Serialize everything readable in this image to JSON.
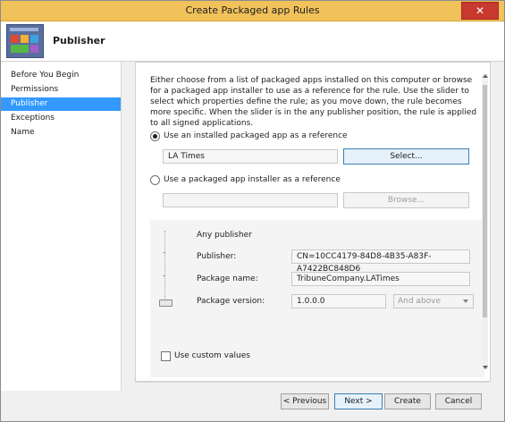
{
  "window": {
    "title": "Create Packaged app Rules",
    "close_glyph": "✕"
  },
  "header": {
    "page_title": "Publisher"
  },
  "sidebar": {
    "items": [
      {
        "label": "Before You Begin"
      },
      {
        "label": "Permissions"
      },
      {
        "label": "Publisher",
        "active": true
      },
      {
        "label": "Exceptions"
      },
      {
        "label": "Name"
      }
    ]
  },
  "main": {
    "description": "Either choose from a list of packaged apps installed on this computer or browse for a packaged app installer to use as a reference for the rule. Use the slider to select which properties define the rule; as you move down, the rule becomes more specific. When the slider is in the any publisher position, the rule is applied to all signed applications.",
    "option_installed": {
      "label": "Use an installed packaged app as a reference",
      "selected": true
    },
    "installed_value": "LA Times",
    "select_button": "Select...",
    "option_installer": {
      "label": "Use a packaged app installer as a reference",
      "selected": false
    },
    "installer_value": "",
    "browse_button": "Browse...",
    "slider": {
      "any_publisher_label": "Any publisher",
      "publisher_label": "Publisher:",
      "publisher_value": "CN=10CC4179-84D8-4B35-A83F-A7422BC848D6",
      "package_name_label": "Package name:",
      "package_name_value": "TribuneCompany.LATimes",
      "package_version_label": "Package version:",
      "package_version_value": "1.0.0.0",
      "version_condition": "And above"
    },
    "custom_values": {
      "label": "Use custom values",
      "checked": false
    }
  },
  "footer": {
    "previous": "< Previous",
    "next": "Next >",
    "create": "Create",
    "cancel": "Cancel"
  }
}
